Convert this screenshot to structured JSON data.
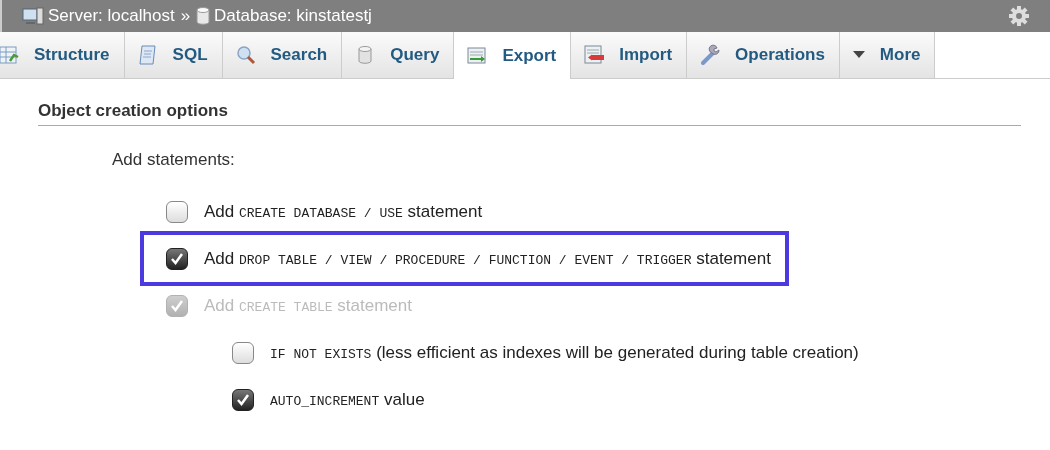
{
  "breadcrumb": [
    {
      "kind": "server",
      "text": "Server: localhost"
    },
    {
      "kind": "separator",
      "text": "»"
    },
    {
      "kind": "database",
      "text": "Database: kinstatestj"
    }
  ],
  "tabs": [
    {
      "label": "Structure",
      "kind": "structure",
      "selected": false
    },
    {
      "label": "SQL",
      "kind": "sql",
      "selected": false
    },
    {
      "label": "Search",
      "kind": "search",
      "selected": false
    },
    {
      "label": "Query",
      "kind": "query",
      "selected": false
    },
    {
      "label": "Export",
      "kind": "export",
      "selected": true
    },
    {
      "label": "Import",
      "kind": "import",
      "selected": false
    },
    {
      "label": "Operations",
      "kind": "operations",
      "selected": false
    },
    {
      "label": "More",
      "kind": "more",
      "selected": false
    }
  ],
  "section": {
    "title": "Object creation options",
    "label": "Add statements:",
    "options": [
      {
        "parts": [
          {
            "kind": "text",
            "text": "Add"
          },
          {
            "kind": "code",
            "text": "CREATE DATABASE / USE"
          },
          {
            "kind": "text",
            "text": "statement"
          }
        ],
        "checked": false,
        "disabled": false,
        "highlighted": false
      },
      {
        "parts": [
          {
            "kind": "text",
            "text": "Add"
          },
          {
            "kind": "code",
            "text": "DROP TABLE / VIEW / PROCEDURE / FUNCTION / EVENT / TRIGGER"
          },
          {
            "kind": "text",
            "text": "statement"
          }
        ],
        "checked": true,
        "disabled": false,
        "highlighted": true
      },
      {
        "parts": [
          {
            "kind": "text",
            "text": "Add"
          },
          {
            "kind": "code",
            "text": "CREATE TABLE"
          },
          {
            "kind": "text",
            "text": "statement"
          }
        ],
        "checked": true,
        "disabled": true,
        "highlighted": false,
        "children": [
          {
            "parts": [
              {
                "kind": "code",
                "text": "IF NOT EXISTS"
              },
              {
                "kind": "text",
                "text": "(less efficient as indexes will be generated during table creation)"
              }
            ],
            "checked": false,
            "disabled": false,
            "highlighted": false
          },
          {
            "parts": [
              {
                "kind": "code",
                "text": "AUTO_INCREMENT"
              },
              {
                "kind": "text",
                "text": "value"
              }
            ],
            "checked": true,
            "disabled": false,
            "highlighted": false
          }
        ]
      }
    ]
  }
}
